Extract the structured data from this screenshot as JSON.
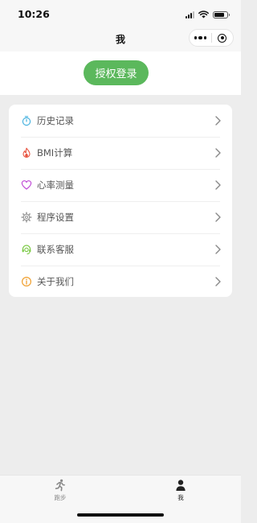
{
  "status_bar": {
    "time": "10:26"
  },
  "navbar": {
    "title": "我"
  },
  "auth_button": {
    "label": "授权登录",
    "color": "#5bb85c"
  },
  "menu": {
    "items": [
      {
        "label": "历史记录",
        "icon": "stopwatch-icon",
        "icon_color": "#49b3e0"
      },
      {
        "label": "BMI计算",
        "icon": "flame-icon",
        "icon_color": "#e8533f"
      },
      {
        "label": "心率测量",
        "icon": "heart-icon",
        "icon_color": "#c04bd6"
      },
      {
        "label": "程序设置",
        "icon": "gear-icon",
        "icon_color": "#999999"
      },
      {
        "label": "联系客服",
        "icon": "headset-icon",
        "icon_color": "#7ac943"
      },
      {
        "label": "关于我们",
        "icon": "info-icon",
        "icon_color": "#f0a030"
      }
    ]
  },
  "tabbar": {
    "tabs": [
      {
        "label": "跑步",
        "icon": "running-icon",
        "active": false
      },
      {
        "label": "我",
        "icon": "person-icon",
        "active": true
      }
    ]
  }
}
